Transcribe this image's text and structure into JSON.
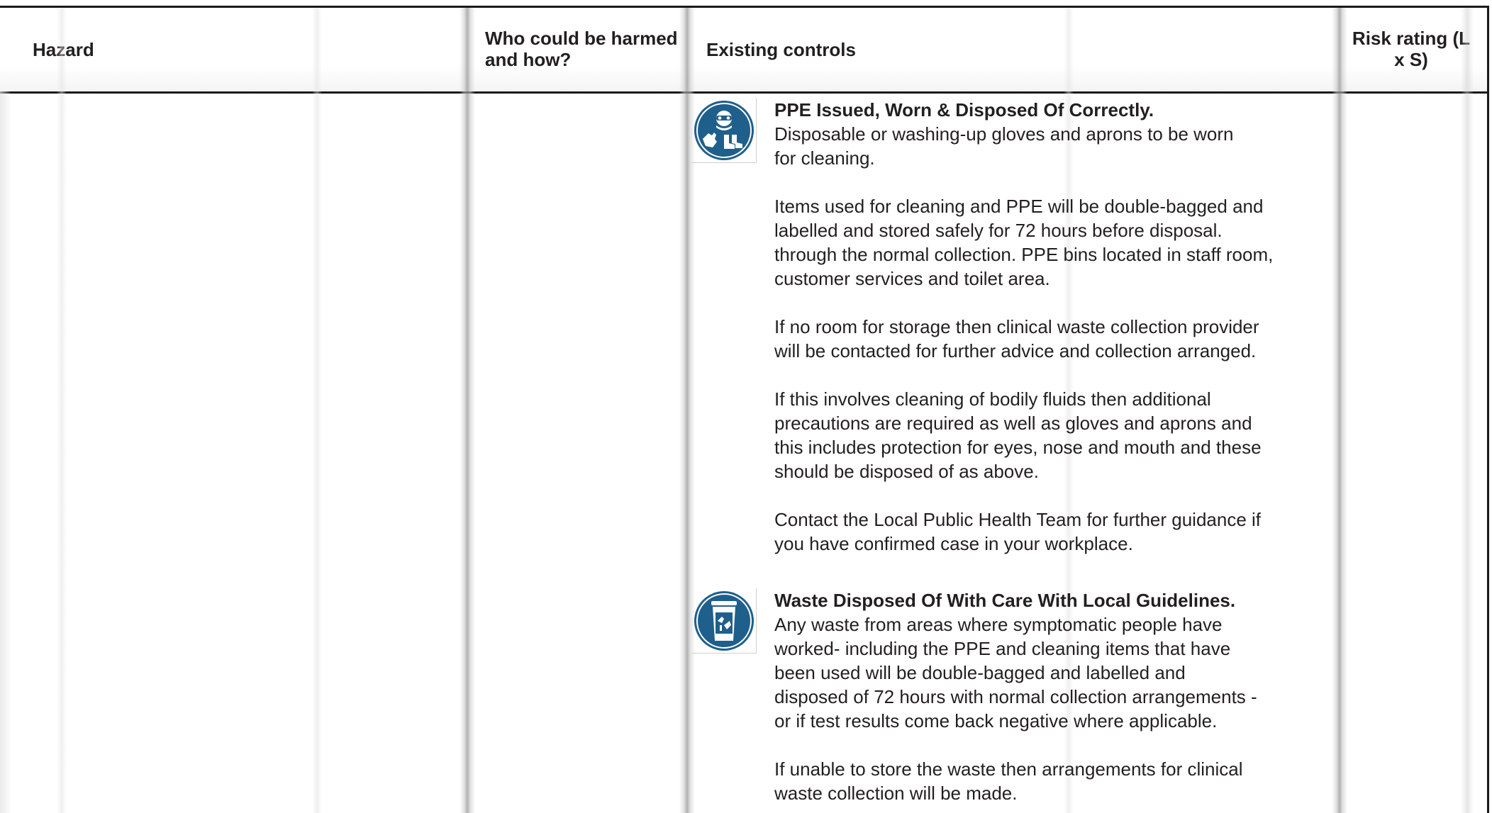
{
  "table": {
    "headers": {
      "hazard": "Hazard",
      "who": "Who could be harmed and how?",
      "controls": "Existing controls",
      "risk": "Risk rating (L x S)"
    }
  },
  "controls": [
    {
      "icon": "ppe-mandatory-icon",
      "title": "PPE Issued, Worn & Disposed Of Correctly.",
      "paragraphs": [
        "Disposable or washing-up gloves and aprons to be worn\nfor cleaning.",
        "Items used for cleaning and PPE will be double-bagged and\nlabelled and stored safely for 72 hours before disposal.\nthrough the normal collection. PPE bins located in staff room,\ncustomer services and toilet area.",
        "If no room for storage then clinical waste collection provider\nwill be contacted for further advice and collection arranged.",
        "If this involves cleaning of bodily fluids then additional\nprecautions are required as well as gloves and aprons and\nthis includes protection for eyes, nose and mouth and these\nshould be disposed of as above.",
        "Contact the Local Public Health Team for further guidance if\nyou have confirmed case in your workplace."
      ]
    },
    {
      "icon": "waste-bin-icon",
      "title": "Waste Disposed Of With Care With Local Guidelines.",
      "paragraphs": [
        "Any waste from areas where symptomatic people have\nworked- including the PPE and cleaning items that have\nbeen used will be double-bagged and labelled and\ndisposed of 72 hours with normal collection arrangements -\nor if test results come back negative where applicable.",
        "If unable to store the waste then arrangements for clinical\nwaste collection will be made."
      ]
    }
  ],
  "colors": {
    "sign_blue": "#1f5f8b",
    "text": "#231f20",
    "rule": "#1a1a1a"
  }
}
